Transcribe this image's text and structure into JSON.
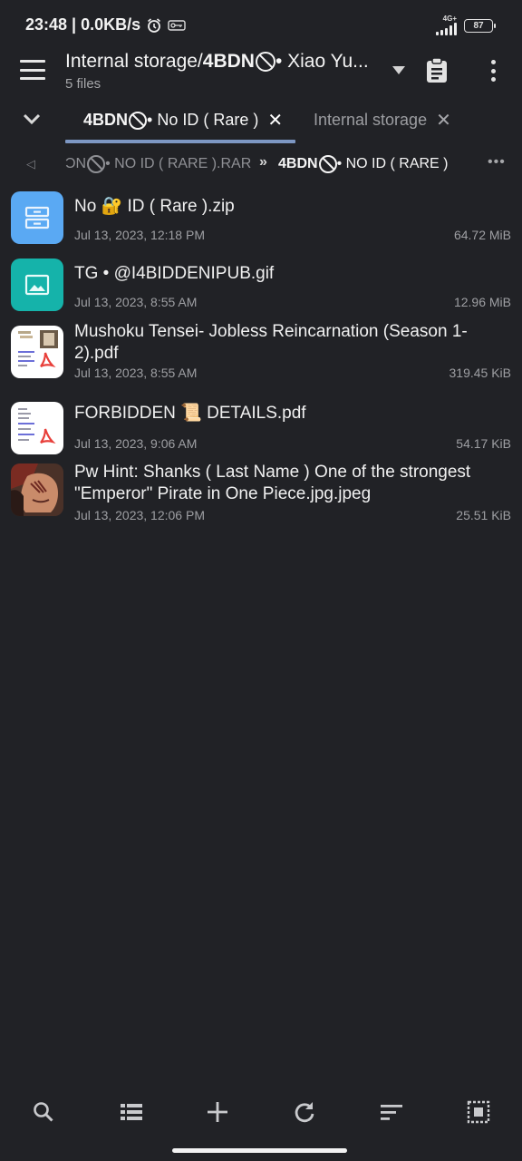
{
  "status_bar": {
    "time_speed": "23:48 | 0.0KB/s",
    "network_type": "4G+",
    "battery": "87",
    "icons": [
      "alarm-icon",
      "vpn-key-icon",
      "signal-icon",
      "battery-icon"
    ]
  },
  "header": {
    "title_prefix": "Internal storage/",
    "title_bold": "4BDN",
    "title_suffix": " • Xiao Yu...",
    "subtitle": "5 files"
  },
  "tabs": [
    {
      "label_bold": "4BDN",
      "label_rest": " • No ID ( Rare )",
      "close": "✕",
      "active": true
    },
    {
      "label": "Internal storage",
      "close": "✕",
      "active": false
    }
  ],
  "breadcrumb": {
    "back": "◁",
    "segment1_prefix": "ƆN",
    "segment1_rest": " • NO ID ( RARE ).RAR",
    "separator": "»",
    "segment2_bold": "4BDN",
    "segment2_rest": " • NO ID ( RARE )",
    "more": "•••"
  },
  "files": [
    {
      "name": "No 🔐 ID ( Rare ).zip",
      "date": "Jul 13, 2023, 12:18 PM",
      "size": "64.72 MiB",
      "icon": "archive-icon"
    },
    {
      "name": "TG • @I4BIDDENIPUB.gif",
      "date": "Jul 13, 2023, 8:55 AM",
      "size": "12.96 MiB",
      "icon": "image-icon"
    },
    {
      "name": "Mushoku Tensei- Jobless Reincarnation (Season 1-2).pdf",
      "date": "Jul 13, 2023, 8:55 AM",
      "size": "319.45  KiB",
      "icon": "pdf-thumbnail"
    },
    {
      "name": "FORBIDDEN 📜 DETAILS.pdf",
      "date": "Jul 13, 2023, 9:06 AM",
      "size": "54.17  KiB",
      "icon": "pdf-thumbnail"
    },
    {
      "name": "Pw Hint: Shanks ( Last Name ) One of the strongest \"Emperor\" Pirate in One Piece.jpg.jpeg",
      "date": "Jul 13, 2023, 12:06 PM",
      "size": "25.51  KiB",
      "icon": "image-thumbnail"
    }
  ],
  "bottom_bar": [
    "search-icon",
    "list-view-icon",
    "add-icon",
    "refresh-icon",
    "sort-icon",
    "select-all-icon"
  ],
  "colors": {
    "background": "#212226",
    "tab_indicator": "#7D97C3",
    "archive_blue": "#5AA9F3",
    "image_teal": "#15B3AA",
    "pdf_red": "#E8403B"
  }
}
